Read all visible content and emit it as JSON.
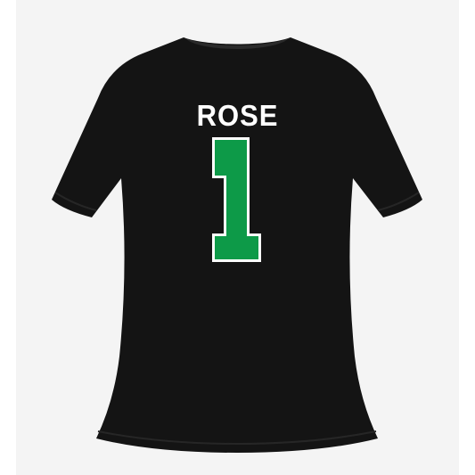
{
  "product": {
    "player_name": "ROSE",
    "player_number": "1"
  },
  "colors": {
    "shirt": "#141414",
    "number_fill": "#0d9a48",
    "number_outline": "#ffffff",
    "name_text": "#ffffff",
    "background": "#f4f4f4"
  }
}
